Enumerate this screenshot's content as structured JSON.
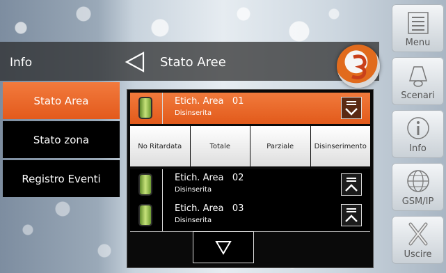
{
  "header": {
    "section": "Info",
    "page_title": "Stato Aree"
  },
  "left_menu": {
    "items": [
      {
        "label": "Stato Area",
        "active": true
      },
      {
        "label": "Stato zona",
        "active": false
      },
      {
        "label": "Registro Eventi",
        "active": false
      }
    ]
  },
  "areas": [
    {
      "name": "Etich. Area   01",
      "status": "Disinserita",
      "selected": true,
      "toggle_icon": "collapse-icon"
    },
    {
      "name": "Etich. Area   02",
      "status": "Disinserita",
      "selected": false,
      "toggle_icon": "expand-icon"
    },
    {
      "name": "Etich. Area   03",
      "status": "Disinserita",
      "selected": false,
      "toggle_icon": "expand-icon"
    }
  ],
  "actions": {
    "no_delay": "No Ritardata",
    "total": "Totale",
    "partial": "Parziale",
    "disarm": "Disinserimento"
  },
  "right_bar": {
    "menu": "Menu",
    "scenari": "Scenari",
    "info": "Info",
    "gsm": "GSM/IP",
    "exit": "Uscire"
  },
  "colors": {
    "accent": "#e8642a",
    "led": "#a8cc5a"
  }
}
